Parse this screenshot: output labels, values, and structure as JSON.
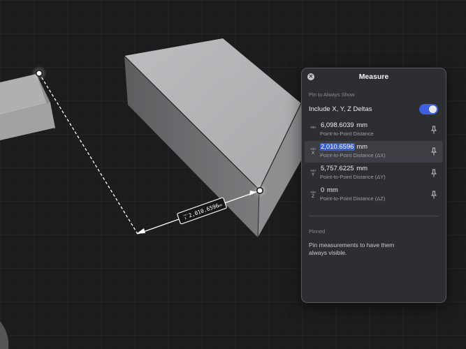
{
  "panel": {
    "title": "Measure",
    "close_icon": "close-icon",
    "pin_section_label": "Pin to Always Show",
    "include_deltas_label": "Include X, Y, Z Deltas",
    "include_deltas_on": true,
    "measurements": [
      {
        "axis_icon": "distance-icon",
        "axis": "",
        "value": "6,098.6039",
        "unit": "mm",
        "description": "Point-to-Point Distance",
        "selected": false
      },
      {
        "axis_icon": "delta-x-icon",
        "axis": "X",
        "value": "2,010.6596",
        "unit": "mm",
        "description": "Point-to-Point Distance (ΔX)",
        "selected": true
      },
      {
        "axis_icon": "delta-y-icon",
        "axis": "Y",
        "value": "5,757.6225",
        "unit": "mm",
        "description": "Point-to-Point Distance (ΔY)",
        "selected": false
      },
      {
        "axis_icon": "delta-z-icon",
        "axis": "Z",
        "value": "0",
        "unit": "mm",
        "description": "Point-to-Point Distance (ΔZ)",
        "selected": false
      }
    ],
    "pinned_section_label": "Pinned",
    "pinned_message": "Pin measurements to have them always visible."
  },
  "viewport": {
    "dimension_label": {
      "axis": "X",
      "value": "2,010.6596",
      "unit": "mm"
    },
    "accent_color": "#3d5fe0"
  }
}
